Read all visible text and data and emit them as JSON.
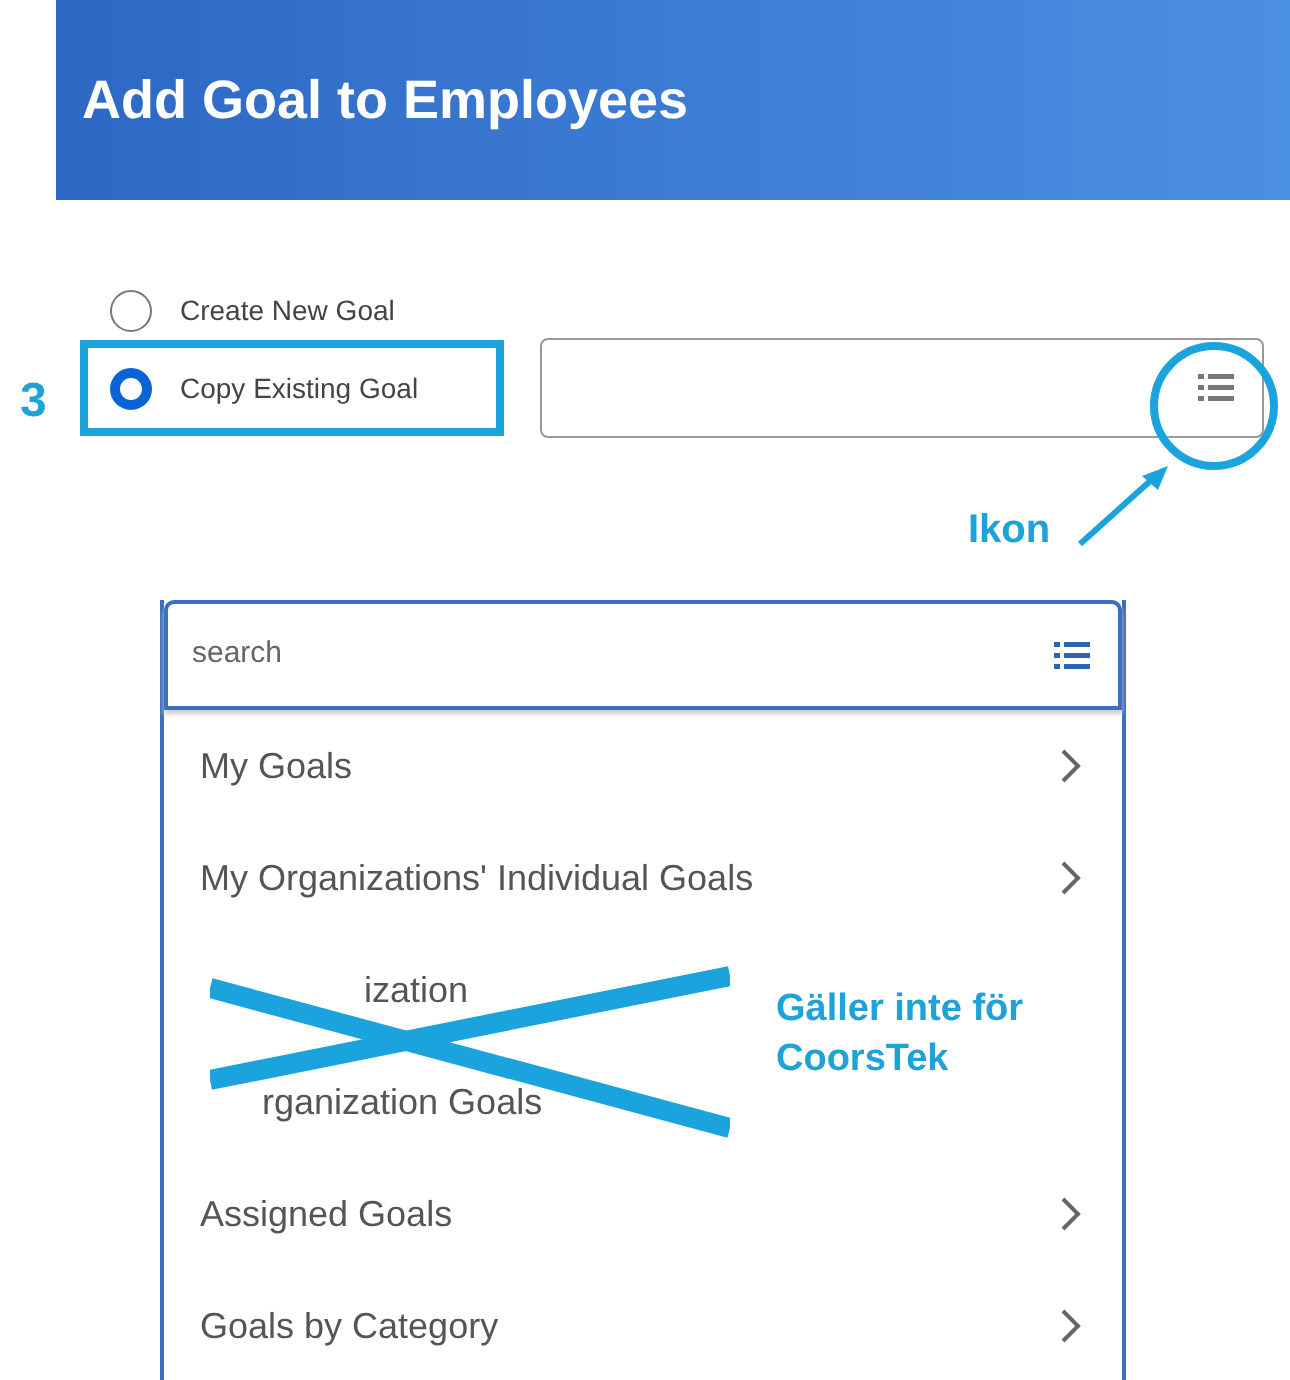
{
  "title": "Add Goal to Employees",
  "radios": [
    {
      "label": "Create New Goal",
      "selected": false,
      "highlighted": false
    },
    {
      "label": "Copy Existing Goal",
      "selected": true,
      "highlighted": true
    }
  ],
  "step_number": "3",
  "icon_note": "Ikon",
  "dropdown": {
    "search_placeholder": "search",
    "items": [
      {
        "label": "My Goals",
        "kind": "submenu"
      },
      {
        "label": "My Organizations' Individual Goals",
        "kind": "submenu"
      },
      {
        "label": "ization",
        "kind": "covered_middle"
      },
      {
        "label": "rganization Goals",
        "kind": "covered_start"
      },
      {
        "label": "Assigned Goals",
        "kind": "submenu"
      },
      {
        "label": "Goals by Category",
        "kind": "submenu"
      }
    ],
    "cross_note": "Gäller inte för CoorsTek"
  }
}
